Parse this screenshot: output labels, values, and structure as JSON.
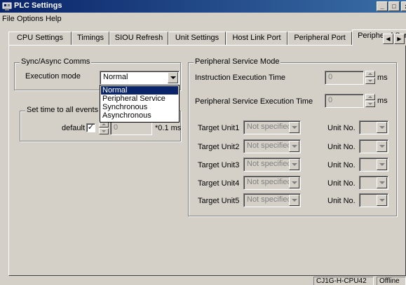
{
  "window": {
    "title": "PLC Settings",
    "controls": [
      "_",
      "□",
      "x"
    ]
  },
  "menu": [
    "File",
    "Options",
    "Help"
  ],
  "tabs": [
    {
      "label": "CPU Settings"
    },
    {
      "label": "Timings"
    },
    {
      "label": "SIOU Refresh"
    },
    {
      "label": "Unit Settings"
    },
    {
      "label": "Host Link Port"
    },
    {
      "label": "Peripheral Port"
    },
    {
      "label": "Peripheral Service",
      "selected": true
    }
  ],
  "sync_group": {
    "title": "Sync/Async Comms",
    "execution_mode_label": "Execution mode",
    "execution_mode_value": "Normal",
    "options": [
      "Normal",
      "Peripheral Service",
      "Synchronous",
      "Asynchronous"
    ],
    "highlighted_option": "Normal"
  },
  "events_group": {
    "title": "Set time to all events",
    "default_label": "default",
    "default_checked": true,
    "checkbox_mark": "✓",
    "time_value": "0",
    "unit": "*0.1 ms"
  },
  "peripheral_group": {
    "title": "Peripheral Service Mode",
    "instruction_label": "Instruction Execution Time",
    "instruction_value": "0",
    "instruction_unit": "ms",
    "peripheral_label": "Peripheral Service Execution Time",
    "peripheral_value": "0",
    "peripheral_unit": "ms",
    "unit_no_label": "Unit No.",
    "targets": [
      {
        "label": "Target Unit1",
        "value": "Not specified"
      },
      {
        "label": "Target Unit2",
        "value": "Not specified"
      },
      {
        "label": "Target Unit3",
        "value": "Not specified"
      },
      {
        "label": "Target Unit4",
        "value": "Not specified"
      },
      {
        "label": "Target Unit5",
        "value": "Not specified"
      }
    ]
  },
  "status": {
    "model": "CJ1G-H-CPU42",
    "state": "Offline"
  },
  "colors": {
    "face": "#d4d0c8",
    "title_start": "#0a246a",
    "title_end": "#3a6ea5",
    "highlight": "#0a246a"
  }
}
